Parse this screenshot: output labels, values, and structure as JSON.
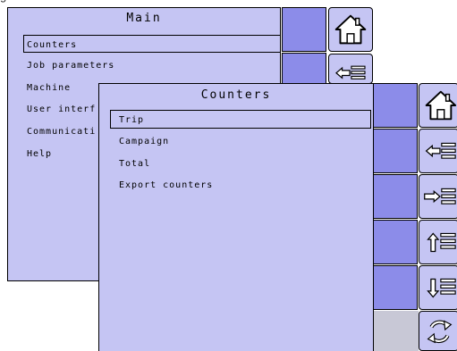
{
  "main": {
    "title": "Main",
    "items": [
      "Counters",
      "Job parameters",
      "Machine",
      "User interf",
      "Communicati",
      "Help"
    ],
    "selected_index": 0
  },
  "counters": {
    "title": "Counters",
    "items": [
      "Trip",
      "Campaign",
      "Total",
      "Export counters"
    ],
    "selected_index": 0
  },
  "colors": {
    "panel": "#c5c5f3",
    "side_square": "#8c8ce9",
    "outline": "#000000"
  },
  "icons": [
    "home-icon",
    "list-back-icon",
    "list-forward-icon",
    "scroll-up-icon",
    "scroll-down-icon",
    "refresh-icon"
  ]
}
